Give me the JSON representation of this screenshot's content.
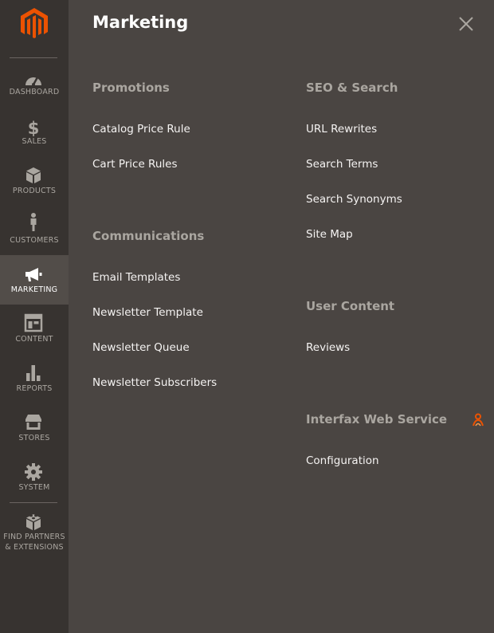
{
  "sidebar": {
    "items": [
      {
        "label": "DASHBOARD"
      },
      {
        "label": "SALES"
      },
      {
        "label": "PRODUCTS"
      },
      {
        "label": "CUSTOMERS"
      },
      {
        "label": "MARKETING"
      },
      {
        "label": "CONTENT"
      },
      {
        "label": "REPORTS"
      },
      {
        "label": "STORES"
      },
      {
        "label": "SYSTEM"
      },
      {
        "label_line1": "FIND PARTNERS",
        "label_line2": "& EXTENSIONS"
      }
    ],
    "active_item": "MARKETING",
    "icons": [
      "magento-logo",
      "dashboard-icon",
      "dollar-icon",
      "box-icon",
      "person-icon",
      "megaphone-icon",
      "content-icon",
      "bar-chart-icon",
      "store-icon",
      "gear-icon",
      "lego-icon"
    ]
  },
  "panel": {
    "title": "Marketing",
    "close_icon": "close-icon",
    "sections": {
      "promotions": {
        "title": "Promotions",
        "links": [
          "Catalog Price Rule",
          "Cart Price Rules"
        ]
      },
      "communications": {
        "title": "Communications",
        "links": [
          "Email Templates",
          "Newsletter Template",
          "Newsletter Queue",
          "Newsletter Subscribers"
        ]
      },
      "seo": {
        "title": "SEO & Search",
        "links": [
          "URL Rewrites",
          "Search Terms",
          "Search Synonyms",
          "Site Map"
        ]
      },
      "user_content": {
        "title": "User Content",
        "links": [
          "Reviews"
        ]
      },
      "interfax": {
        "title": "Interfax Web Service",
        "links": [
          "Configuration"
        ],
        "icon": "interfax-icon"
      }
    }
  },
  "colors": {
    "sidebar_bg": "#373330",
    "panel_bg": "#4a4542",
    "active_bg": "#524d49",
    "accent": "#eb5202",
    "section_title": "#aaa6a0",
    "link": "#f5f3f2"
  }
}
